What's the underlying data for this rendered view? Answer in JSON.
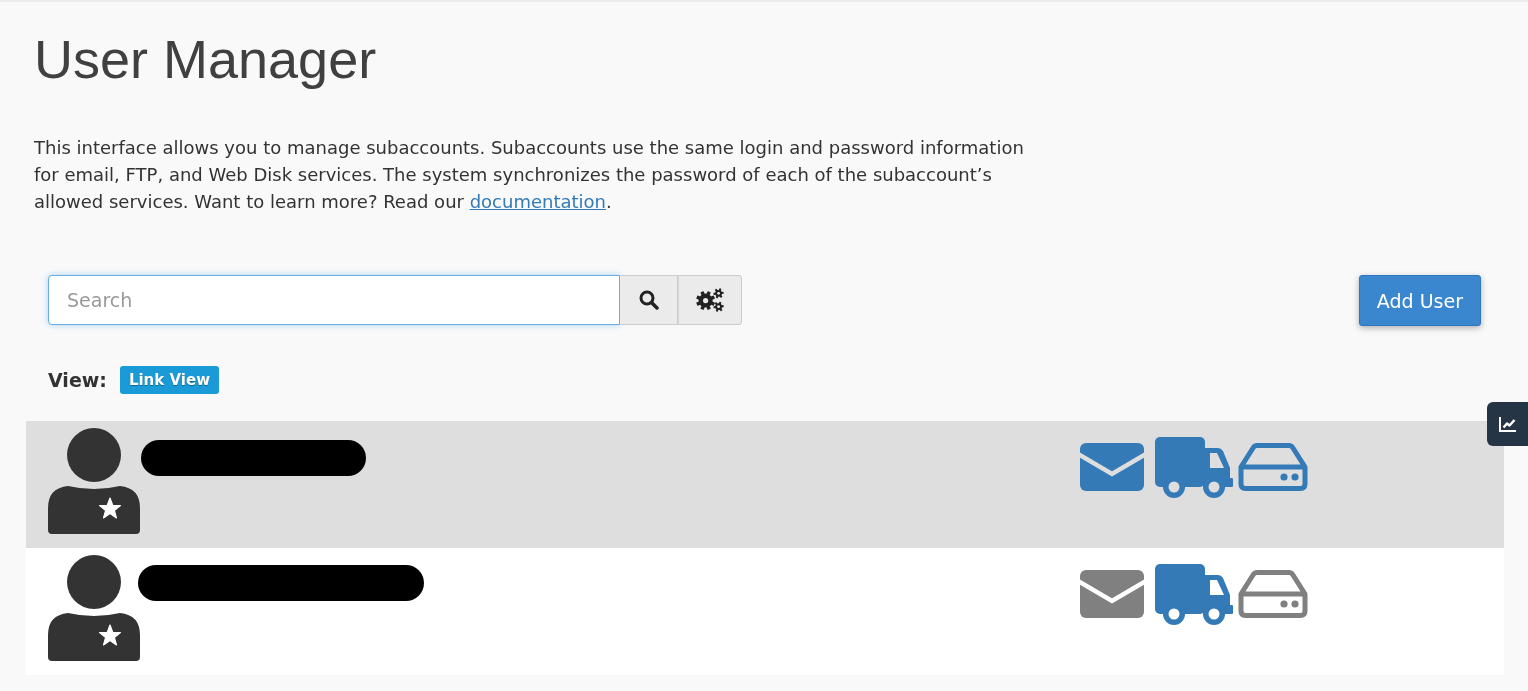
{
  "page": {
    "title": "User Manager",
    "description": {
      "text": "This interface allows you to manage subaccounts. Subaccounts use the same login and password information for email, FTP, and Web Disk services. The system synchronizes the password of each of the subaccount’s allowed services. Want to learn more? Read our ",
      "link": "documentation",
      "after": "."
    }
  },
  "toolbar": {
    "search": {
      "placeholder": "Search"
    },
    "add_button": "Add User"
  },
  "view": {
    "label": "View:",
    "option": "Link View"
  },
  "users": [
    {
      "selected": true,
      "name_redacted": true,
      "services": [
        {
          "kind": "email",
          "enabled": true
        },
        {
          "kind": "ftp",
          "enabled": true
        },
        {
          "kind": "webdisk",
          "enabled": true
        }
      ]
    },
    {
      "selected": false,
      "name_redacted": true,
      "services": [
        {
          "kind": "email",
          "enabled": false
        },
        {
          "kind": "ftp",
          "enabled": true
        },
        {
          "kind": "webdisk",
          "enabled": false
        }
      ]
    }
  ]
}
